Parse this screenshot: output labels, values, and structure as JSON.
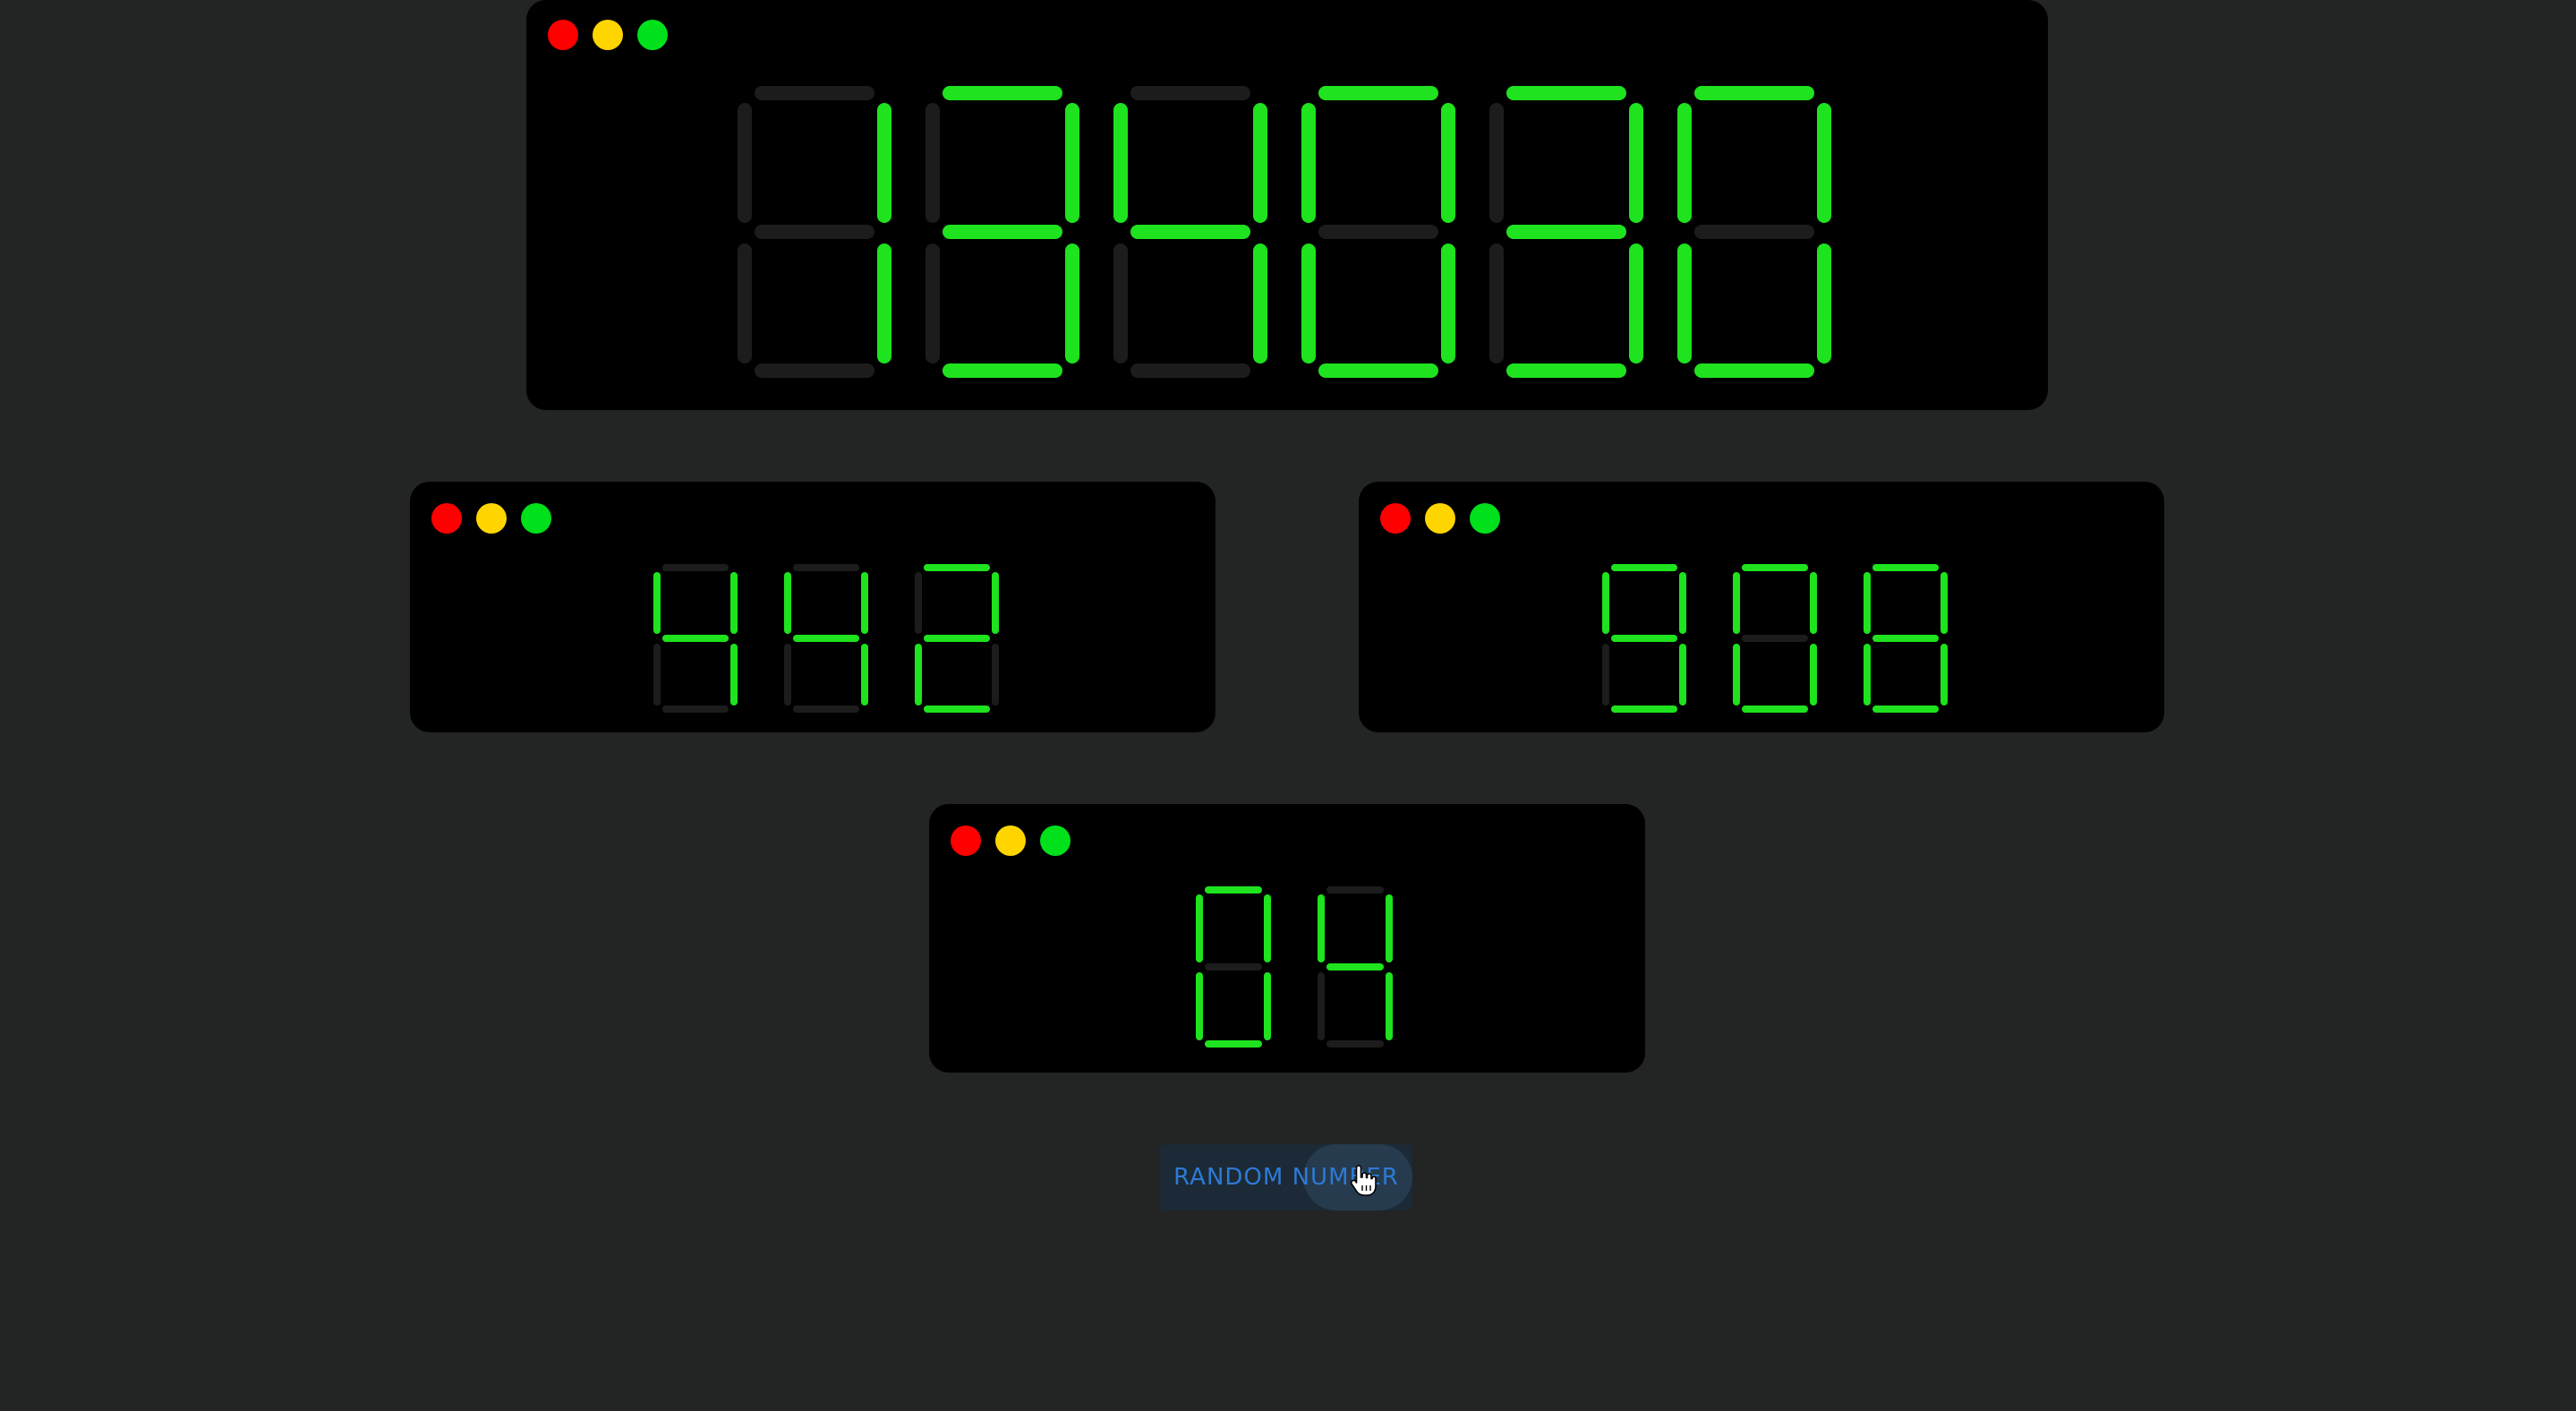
{
  "colors": {
    "background": "#232525",
    "panel": "#000000",
    "segment_on": "#1ee31e",
    "segment_off": "#1c1c1c",
    "dot_red": "#ff0000",
    "dot_yellow": "#ffd500",
    "dot_green": "#00e01b",
    "button_text": "#2d7ad6"
  },
  "window_controls": [
    "close-dot",
    "minimize-dot",
    "maximize-dot"
  ],
  "displays": [
    {
      "id": "display-large",
      "value": "134030"
    },
    {
      "id": "display-left",
      "value": "442"
    },
    {
      "id": "display-right",
      "value": "908"
    },
    {
      "id": "display-bottom",
      "value": "04"
    }
  ],
  "button": {
    "label": "RANDOM NUMBER"
  },
  "cursor_icon": "hand-pointer-icon"
}
